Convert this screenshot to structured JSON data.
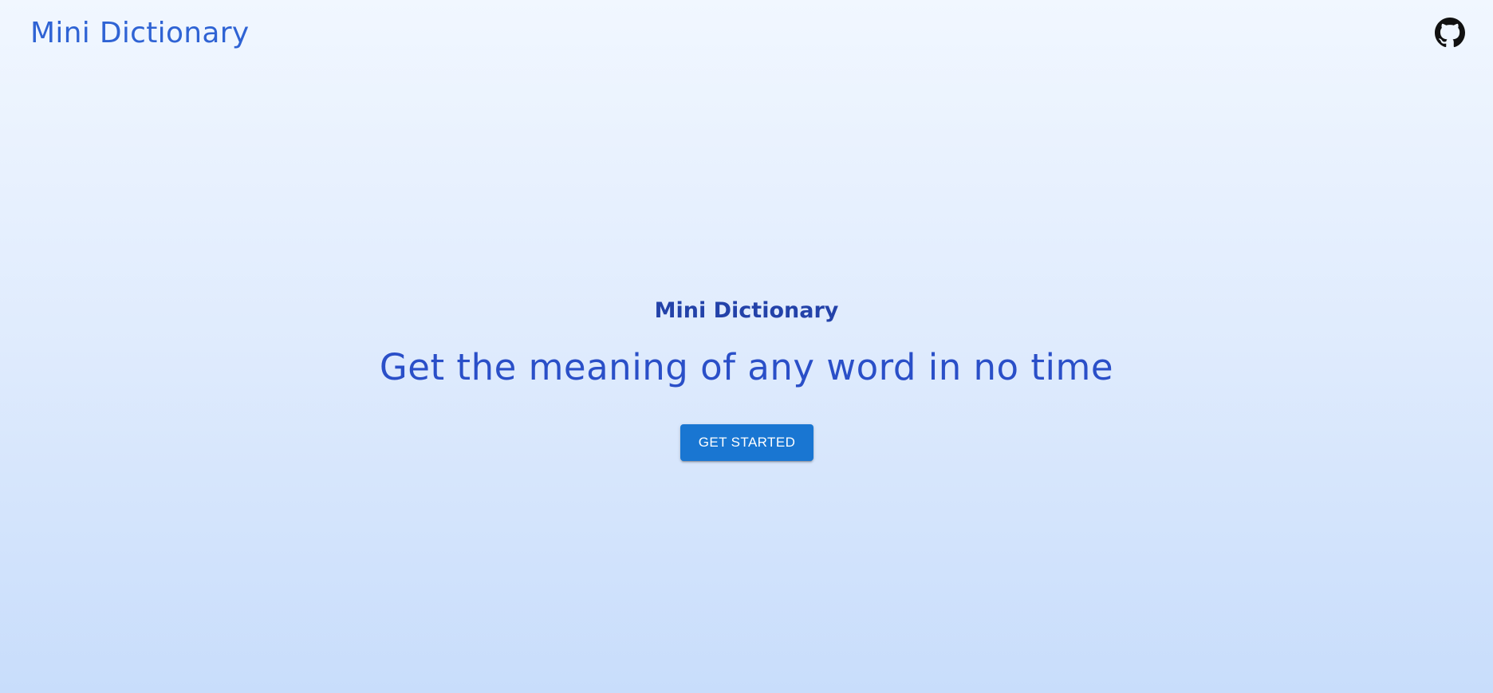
{
  "header": {
    "app_title": "Mini Dictionary",
    "github_icon": "github-icon"
  },
  "hero": {
    "title": "Mini Dictionary",
    "tagline": "Get the meaning of any word in no time",
    "cta_label": "GET STARTED"
  },
  "colors": {
    "brand_blue": "#2f63d4",
    "title_blue": "#2342a9",
    "tagline_blue": "#2a4fc8",
    "button_blue": "#1976d2",
    "background_top": "#f1f7ff",
    "background_bottom": "#c8ddfb"
  }
}
